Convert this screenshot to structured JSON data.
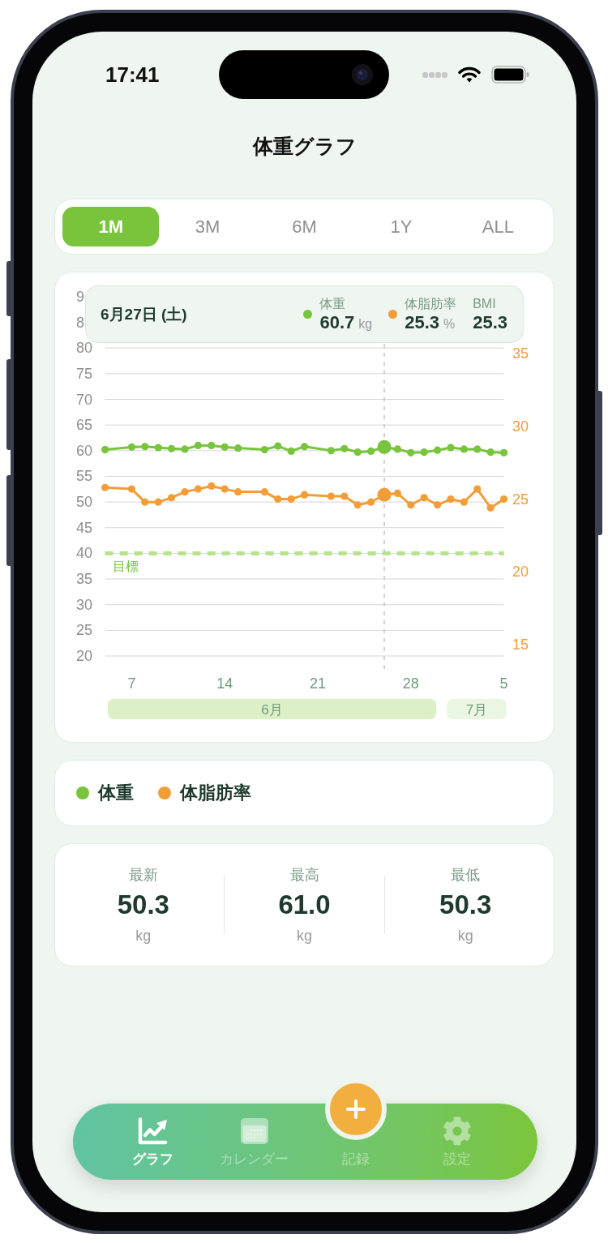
{
  "status_bar": {
    "time": "17:41"
  },
  "header": {
    "title": "体重グラフ"
  },
  "periods": [
    {
      "label": "1M",
      "selected": true
    },
    {
      "label": "3M",
      "selected": false
    },
    {
      "label": "6M",
      "selected": false
    },
    {
      "label": "1Y",
      "selected": false
    },
    {
      "label": "ALL",
      "selected": false
    }
  ],
  "chart": {
    "covered_axis_labels": [
      "9",
      "8"
    ],
    "tooltip": {
      "date": "6月27日 (土)",
      "items": [
        {
          "label": "体重",
          "value": "60.7",
          "unit": "kg",
          "color": "#78c43c"
        },
        {
          "label": "体脂肪率",
          "value": "25.3",
          "unit": "%",
          "color": "#f29d38"
        },
        {
          "label": "BMI",
          "value": "25.3"
        }
      ]
    },
    "chart_data": {
      "type": "line",
      "x": [
        "--06-05",
        "--06-07",
        "--06-08",
        "--06-09",
        "--06-10",
        "--06-11",
        "--06-12",
        "--06-13",
        "--06-14",
        "--06-15",
        "--06-17",
        "--06-18",
        "--06-19",
        "--06-20",
        "--06-22",
        "--06-23",
        "--06-24",
        "--06-25",
        "--06-26",
        "--06-27",
        "--06-28",
        "--06-29",
        "--06-30",
        "--07-01",
        "--07-02",
        "--07-03",
        "--07-04",
        "--07-05"
      ],
      "series": [
        {
          "name": "体重",
          "color": "#78c43c",
          "marker": "o",
          "values": [
            60.2,
            60.7,
            60.8,
            60.6,
            60.4,
            60.3,
            61.0,
            61.0,
            60.7,
            60.5,
            60.2,
            60.9,
            59.9,
            60.8,
            60.0,
            60.4,
            59.7,
            59.9,
            60.7,
            60.3,
            59.6,
            59.7,
            60.1,
            60.6,
            60.3,
            60.3,
            59.7,
            59.6
          ]
        },
        {
          "name": "体脂肪率",
          "color": "#f29d38",
          "marker": "o",
          "axis": "y2",
          "values": [
            25.8,
            25.7,
            24.8,
            24.8,
            25.1,
            25.5,
            25.7,
            25.9,
            25.7,
            25.5,
            25.5,
            25.0,
            25.0,
            25.3,
            25.2,
            25.2,
            24.6,
            24.8,
            25.3,
            25.4,
            24.6,
            25.1,
            24.6,
            25.0,
            24.8,
            25.7,
            24.4,
            25.0
          ]
        }
      ],
      "xlim": [
        "--06-05",
        "--07-05"
      ],
      "ylim": [
        20,
        80
      ],
      "y2lim": [
        15,
        35
      ],
      "xticks": [
        {
          "value": "--06-07",
          "label": "7"
        },
        {
          "value": "--06-14",
          "label": "14"
        },
        {
          "value": "--06-21",
          "label": "21"
        },
        {
          "value": "--06-28",
          "label": "28"
        },
        {
          "value": "--07-05",
          "label": "5"
        }
      ],
      "yticks": [
        80,
        75,
        70,
        65,
        60,
        55,
        50,
        45,
        40,
        35,
        30,
        25,
        20
      ],
      "y2ticks": [
        35,
        30,
        25,
        20,
        15
      ],
      "grid": true,
      "ref_lines": [
        {
          "axis": "y",
          "value": 40,
          "label": "目標"
        },
        {
          "axis": "x",
          "value": "--06-26"
        }
      ]
    },
    "month_strip": [
      {
        "label": "6月",
        "color": "#dcf0c8"
      },
      {
        "label": "7月",
        "color": "#ebf6e2"
      }
    ]
  },
  "stats": [
    {
      "label": "最新",
      "value": "50.3",
      "unit": "kg"
    },
    {
      "label": "最高",
      "value": "61.0",
      "unit": "kg"
    },
    {
      "label": "最低",
      "value": "50.3",
      "unit": "kg"
    }
  ],
  "tab_bar": [
    {
      "label": "グラフ",
      "kind": "tab",
      "selected": true
    },
    {
      "label": "カレンダー",
      "kind": "tab",
      "selected": false
    },
    {
      "label": "記録",
      "kind": "action",
      "selected": false
    },
    {
      "label": "設定",
      "kind": "tab",
      "selected": false
    }
  ]
}
